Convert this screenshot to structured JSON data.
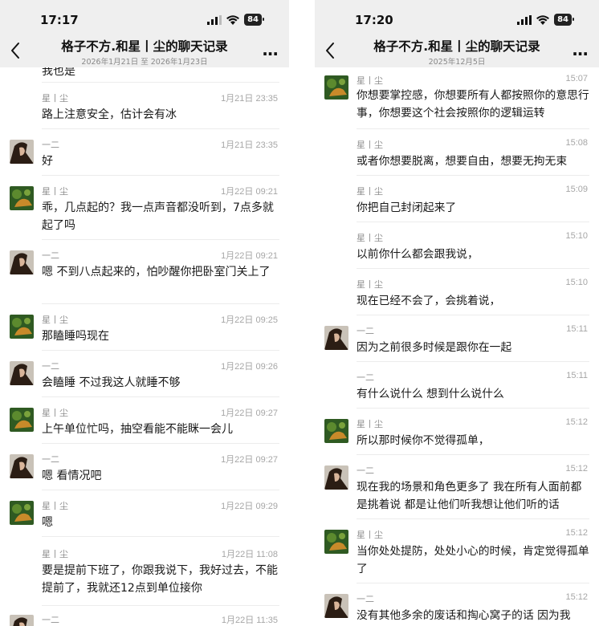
{
  "colors": {
    "header_bg": "#efefef",
    "text": "#191919",
    "meta": "#8f8f8f",
    "avatar_a_bg": "#3d6b2a",
    "avatar_b_bg": "#3b2a1e"
  },
  "left": {
    "status_time": "17:17",
    "battery": "84",
    "title": "格子不方.和星丨尘的聊天记录",
    "subtitle": "2026年1月21日 至 2026年1月23日",
    "more": "...",
    "partial_top_text": "我也是",
    "messages": [
      {
        "sender": "星丨尘",
        "time": "1月21日 23:35",
        "text": "路上注意安全，估计会有冰",
        "avatar": "none"
      },
      {
        "sender": "一二",
        "time": "1月21日 23:35",
        "text": "好",
        "avatar": "b"
      },
      {
        "sender": "星丨尘",
        "time": "1月22日 09:21",
        "text": "乖，几点起的？我一点声音都没听到，7点多就起了吗",
        "avatar": "a"
      },
      {
        "sender": "一二",
        "time": "1月22日 09:21",
        "text": "嗯 不到八点起来的，怕吵醒你把卧室门关上了",
        "avatar": "b"
      },
      {
        "sender": "星丨尘",
        "time": "1月22日 09:25",
        "text": "那瞌睡吗现在",
        "avatar": "a"
      },
      {
        "sender": "一二",
        "time": "1月22日 09:26",
        "text": "会瞌睡 不过我这人就睡不够",
        "avatar": "b"
      },
      {
        "sender": "星丨尘",
        "time": "1月22日 09:27",
        "text": "上午单位忙吗，抽空看能不能眯一会儿",
        "avatar": "a"
      },
      {
        "sender": "一二",
        "time": "1月22日 09:27",
        "text": "嗯 看情况吧",
        "avatar": "b"
      },
      {
        "sender": "星丨尘",
        "time": "1月22日 09:29",
        "text": "嗯",
        "avatar": "a"
      },
      {
        "sender": "星丨尘",
        "time": "1月22日 11:08",
        "text": "要是提前下班了，你跟我说下，我好过去，不能提前了，我就还12点到单位接你",
        "avatar": "none"
      },
      {
        "sender": "一二",
        "time": "1月22日 11:35",
        "text": "",
        "avatar": "b"
      }
    ]
  },
  "right": {
    "status_time": "17:20",
    "battery": "84",
    "title": "格子不方.和星丨尘的聊天记录",
    "subtitle": "2025年12月5日",
    "more": "...",
    "messages": [
      {
        "sender": "星丨尘",
        "time": "15:07",
        "text": "你想要掌控感，你想要所有人都按照你的意思行事，你想要这个社会按照你的逻辑运转",
        "avatar": "a"
      },
      {
        "sender": "星丨尘",
        "time": "15:08",
        "text": "或者你想要脱离，想要自由，想要无拘无束",
        "avatar": "none"
      },
      {
        "sender": "星丨尘",
        "time": "15:09",
        "text": "你把自己封闭起来了",
        "avatar": "none"
      },
      {
        "sender": "星丨尘",
        "time": "15:10",
        "text": "以前你什么都会跟我说，",
        "avatar": "none"
      },
      {
        "sender": "星丨尘",
        "time": "15:10",
        "text": "现在已经不会了，会挑着说，",
        "avatar": "none"
      },
      {
        "sender": "一二",
        "time": "15:11",
        "text": "因为之前很多时候是跟你在一起",
        "avatar": "b"
      },
      {
        "sender": "一二",
        "time": "15:11",
        "text": "有什么说什么 想到什么说什么",
        "avatar": "none"
      },
      {
        "sender": "星丨尘",
        "time": "15:12",
        "text": "所以那时候你不觉得孤单，",
        "avatar": "a"
      },
      {
        "sender": "一二",
        "time": "15:12",
        "text": "现在我的场景和角色更多了 我在所有人面前都是挑着说 都是让他们听我想让他们听的话",
        "avatar": "b"
      },
      {
        "sender": "星丨尘",
        "time": "15:12",
        "text": "当你处处提防，处处小心的时候，肯定觉得孤单了",
        "avatar": "a"
      },
      {
        "sender": "一二",
        "time": "15:12",
        "text": "没有其他多余的废话和掏心窝子的话 因为我",
        "avatar": "b"
      }
    ]
  }
}
